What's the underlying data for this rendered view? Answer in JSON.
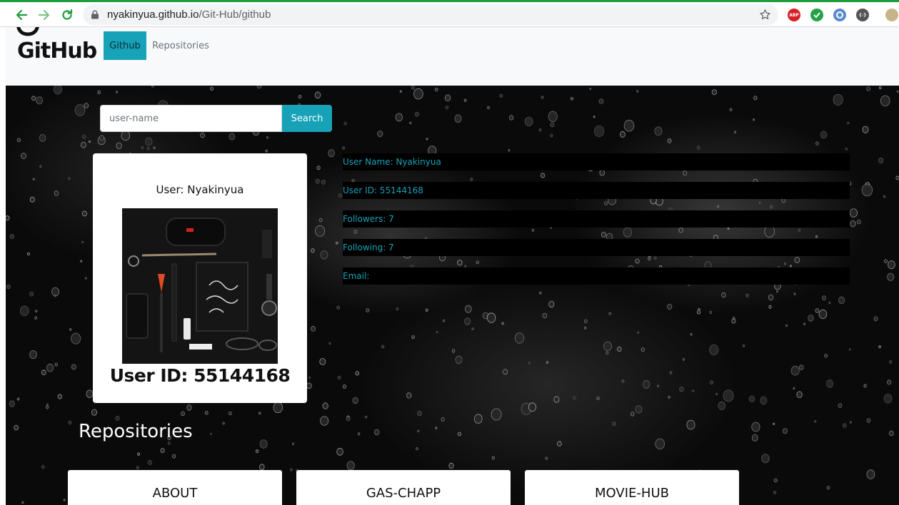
{
  "browser": {
    "url_host": "nyakinyua.github.io",
    "url_path": "/Git-Hub/github",
    "extensions": [
      {
        "icon": "adblock-plus-icon",
        "label": "ABP",
        "color": "#d61f26"
      },
      {
        "icon": "shield-check-icon",
        "label": "",
        "color": "#24a248"
      },
      {
        "icon": "circle-extension-icon",
        "label": "",
        "color": "#5a8bd0"
      },
      {
        "icon": "code-extension-icon",
        "label": "{·}",
        "color": "#555555"
      }
    ]
  },
  "navbar": {
    "brand": "GitHub",
    "links": [
      {
        "label": "Github",
        "active": true
      },
      {
        "label": "Repositories",
        "active": false
      }
    ]
  },
  "search": {
    "placeholder": "user-name",
    "value": "",
    "button_label": "Search"
  },
  "profile": {
    "user_label": "User: Nyakinyua",
    "id_label": "User ID: 55144168"
  },
  "details": [
    "User Name: Nyakinyua",
    "User ID: 55144168",
    "Followers: 7",
    "Following: 7",
    "Email:"
  ],
  "repositories": {
    "heading": "Repositories",
    "items": [
      "ABOUT",
      "GAS-CHAPP",
      "MOVIE-HUB"
    ]
  },
  "colors": {
    "accent": "#17a2b8",
    "navbar_bg": "#f8f9fa",
    "hero_bg": "#0a0a0a"
  }
}
